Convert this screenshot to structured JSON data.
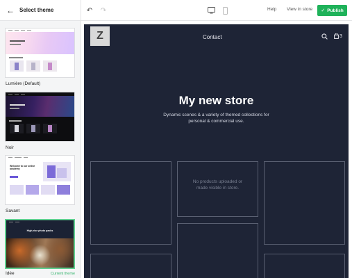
{
  "sidebar": {
    "title": "Select theme",
    "themes": [
      {
        "name": "Lumière (Default)"
      },
      {
        "name": "Noir"
      },
      {
        "name": "Savant",
        "headline": "Welcome to our online academy"
      },
      {
        "name": "Idée",
        "status": "Current theme",
        "headline": "High-rise photo packs"
      }
    ]
  },
  "toolbar": {
    "help_label": "Help",
    "view_label": "View in store",
    "publish_label": "Publish"
  },
  "store": {
    "logo_letter": "Z",
    "nav_link": "Contact",
    "cart_count": "3",
    "hero_title": "My new store",
    "hero_subtitle": "Dynamic scenes & a variety of themed collections for personal & commercial use.",
    "empty_message": "No products uploaded or made visible in store."
  },
  "colors": {
    "accent": "#1fb25a",
    "selected_border": "#5fcf8f",
    "store_bg": "#1e2436"
  }
}
